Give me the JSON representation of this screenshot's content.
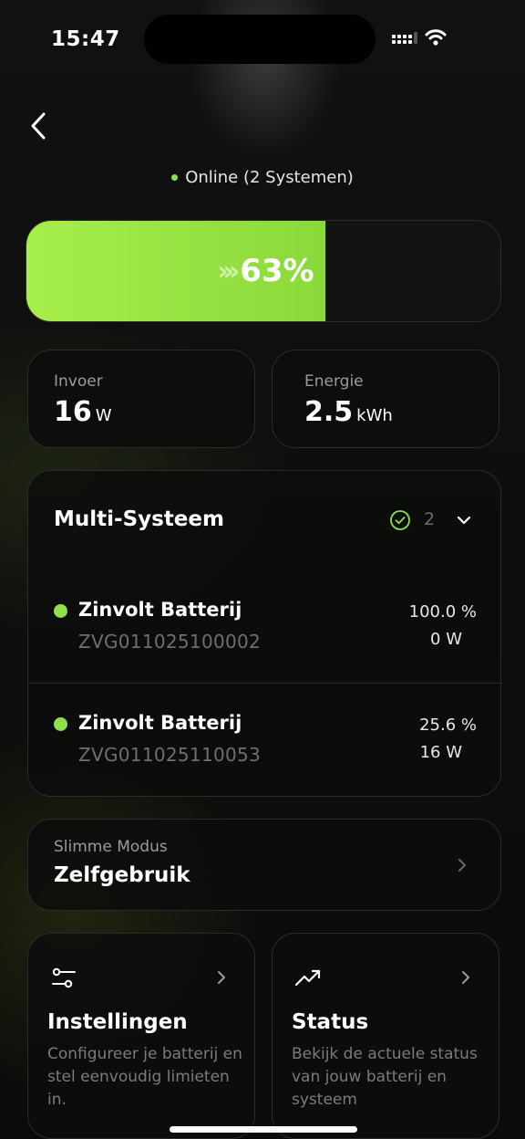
{
  "status_bar": {
    "time": "15:47"
  },
  "header": {
    "online_text": "Online (2 Systemen)",
    "online_color": "#8fe04a"
  },
  "battery": {
    "percent_label": "63%",
    "level": 0.63,
    "fill_color": "#a6ee4c"
  },
  "stats": [
    {
      "label": "Invoer",
      "value": "16",
      "unit": "W"
    },
    {
      "label": "Energie",
      "value": "2.5",
      "unit": "kWh"
    }
  ],
  "multi": {
    "title": "Multi-Systeem",
    "count": "2",
    "systems": [
      {
        "name": "Zinvolt Batterij",
        "serial": "ZVG011025100002",
        "percent": "100.0 %",
        "power": "0 W"
      },
      {
        "name": "Zinvolt Batterij",
        "serial": "ZVG011025110053",
        "percent": "25.6 %",
        "power": "16 W"
      }
    ]
  },
  "mode": {
    "label": "Slimme Modus",
    "value": "Zelfgebruik"
  },
  "actions": [
    {
      "title": "Instellingen",
      "description": "Configureer je batterij en stel eenvoudig limieten in.",
      "icon": "sliders-icon"
    },
    {
      "title": "Status",
      "description": "Bekijk de actuele status van jouw batterij en systeem",
      "icon": "trending-up-icon"
    }
  ]
}
